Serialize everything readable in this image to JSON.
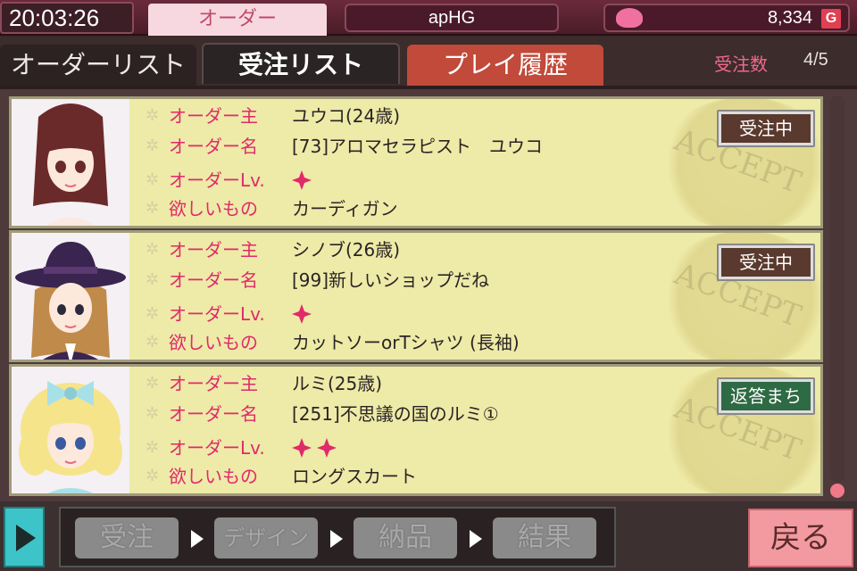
{
  "status_bar": {
    "clock": "20:03:26",
    "mode_tab": "オーダー",
    "player_name": "apHG",
    "money": "8,334",
    "currency_symbol": "G"
  },
  "tabs": [
    {
      "label": "オーダーリスト"
    },
    {
      "label": "受注リスト"
    },
    {
      "label": "プレイ履歴"
    }
  ],
  "order_count": {
    "label": "受注数",
    "value": "4/5"
  },
  "field_labels": {
    "client": "オーダー主",
    "name": "オーダー名",
    "level": "オーダーLv.",
    "wish": "欲しいもの"
  },
  "orders": [
    {
      "client": "ユウコ(24歳)",
      "name": "[73]アロマセラピスト　ユウコ",
      "level": 1,
      "wish": "カーディガン",
      "status": "受注中",
      "status_type": "accepted"
    },
    {
      "client": "シノブ(26歳)",
      "name": "[99]新しいショップだね",
      "level": 1,
      "wish": "カットソーorTシャツ (長袖)",
      "status": "受注中",
      "status_type": "accepted"
    },
    {
      "client": "ルミ(25歳)",
      "name": "[251]不思議の国のルミ①",
      "level": 2,
      "wish": "ロングスカート",
      "status": "返答まち",
      "status_type": "reply"
    }
  ],
  "steps": [
    {
      "label": "受注"
    },
    {
      "label": "デザイン"
    },
    {
      "label": "納品"
    },
    {
      "label": "結果"
    }
  ],
  "back_label": "戻る",
  "colors": {
    "label_pink": "#e02a6a",
    "card_bg": "#eeeaa8",
    "accepted_badge": "#5a3a2e",
    "reply_badge": "#2e6a44",
    "back_button": "#f29aa0"
  }
}
